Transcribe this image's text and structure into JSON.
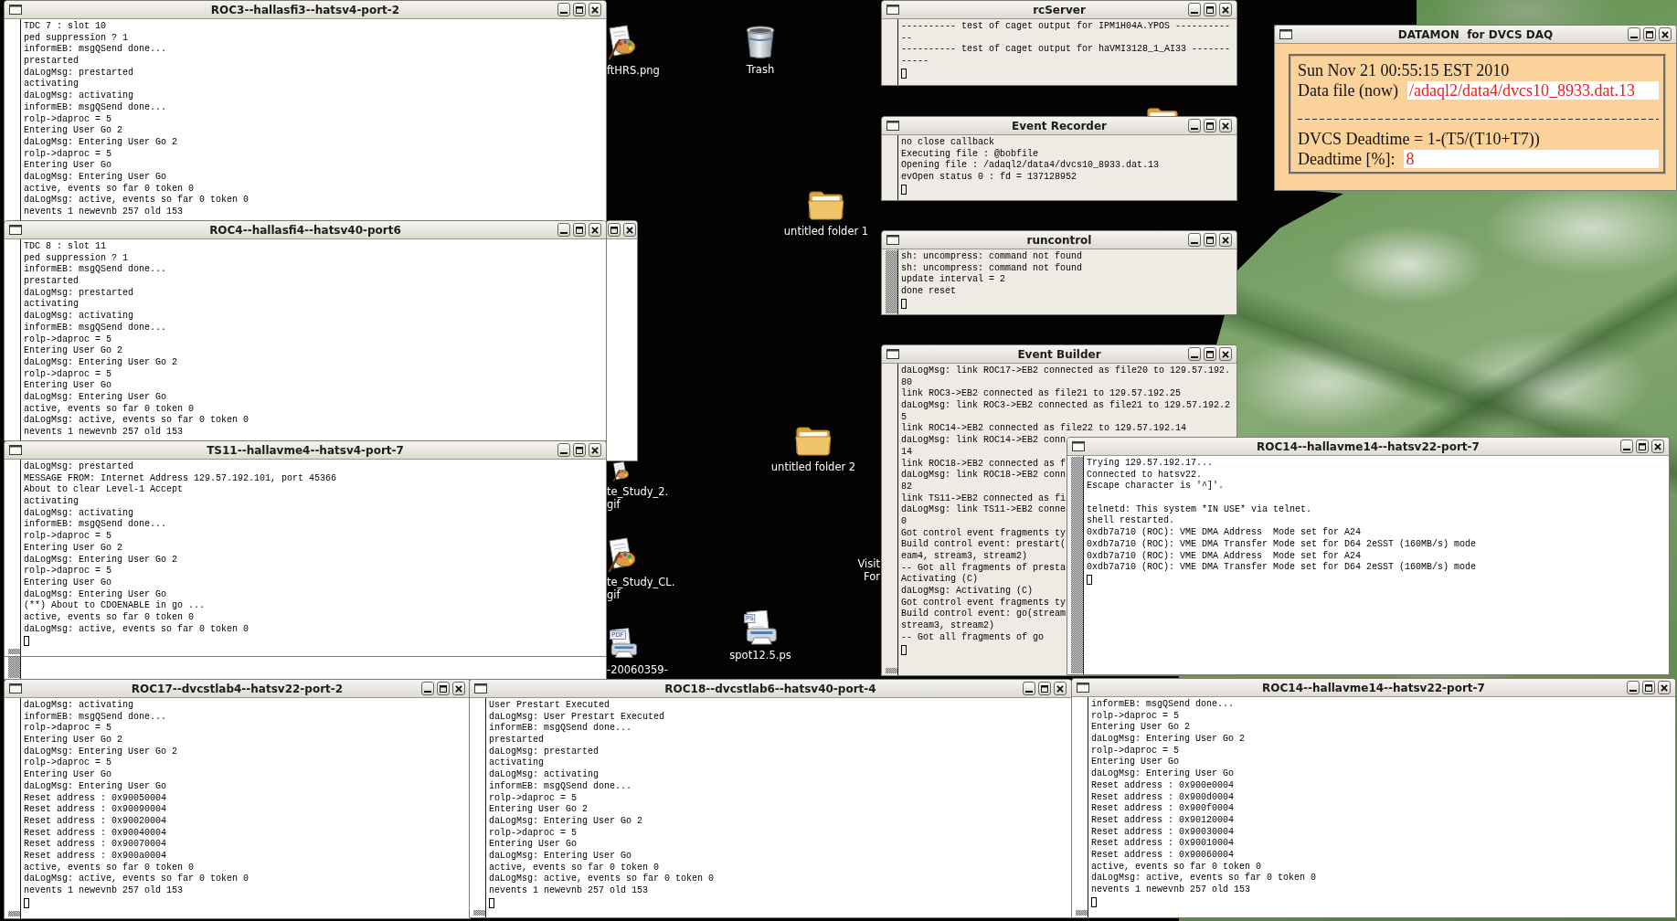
{
  "desktop": {
    "icons": [
      {
        "kind": "image",
        "label": [
          "ftHRS.png"
        ]
      },
      {
        "kind": "trash",
        "label": [
          "Trash"
        ]
      },
      {
        "kind": "folder"
      },
      {
        "kind": "folder",
        "label": [
          "untitled folder 1"
        ]
      },
      {
        "kind": "folder",
        "label": [
          "untitled folder 2"
        ]
      },
      {
        "kind": "image",
        "label": [
          "te_Study_2.",
          "gif"
        ]
      },
      {
        "kind": "link",
        "label": [
          "Visit",
          "For"
        ]
      },
      {
        "kind": "image",
        "label": [
          "te_Study_CL.",
          "gif"
        ]
      },
      {
        "kind": "ps",
        "badge": "PS",
        "label": [
          "spot12.5.ps"
        ]
      },
      {
        "kind": "pdf",
        "badge": "PDF",
        "label": [
          "-20060359-"
        ]
      }
    ]
  },
  "windows": [
    {
      "kind": "fragment",
      "title_bar": true
    },
    {
      "kind": "fragment",
      "scroll_thumb": {
        "kind": "full"
      }
    },
    {
      "kind": "terminal",
      "title": "ROC3--hallasfi3--hatsv4-port-2",
      "cursor": false,
      "output": [
        [
          "TDC 7 : slot 10",
          "ped suppression ? 1",
          "informEB: msgQSend done...",
          "prestarted",
          "daLogMsg: prestarted",
          "activating",
          "daLogMsg: activating",
          "informEB: msgQSend done...",
          "rolp->daproc = 5",
          "Entering User Go 2",
          "daLogMsg: Entering User Go 2",
          "rolp->daproc = 5",
          "Entering User Go",
          "daLogMsg: Entering User Go",
          "active, events so far 0 token 0",
          "daLogMsg: active, events so far 0 token 0",
          "nevents 1 newevnb 257 old 153"
        ]
      ]
    },
    {
      "kind": "terminal",
      "title": "ROC4--hallasfi4--hatsv40-port6",
      "cursor": false,
      "output": [
        [
          "TDC 8 : slot 11",
          "ped suppression ? 1",
          "informEB: msgQSend done...",
          "prestarted",
          "daLogMsg: prestarted",
          "activating",
          "daLogMsg: activating",
          "informEB: msgQSend done...",
          "rolp->daproc = 5",
          "Entering User Go 2",
          "daLogMsg: Entering User Go 2",
          "rolp->daproc = 5",
          "Entering User Go",
          "daLogMsg: Entering User Go",
          "active, events so far 0 token 0",
          "daLogMsg: active, events so far 0 token 0",
          "nevents 1 newevnb 257 old 153"
        ]
      ]
    },
    {
      "kind": "terminal",
      "title": "TS11--hallavme4--hatsv4-port-7",
      "cursor": true,
      "scroll_thumb": {
        "kind": "bottom"
      },
      "output": [
        [
          "daLogMsg: prestarted",
          "MESSAGE FROM: Internet Address 129.57.192.101, port 45366",
          "About to clear Level-1 Accept",
          "activating",
          "daLogMsg: activating",
          "informEB: msgQSend done...",
          "rolp->daproc = 5",
          "Entering User Go 2",
          "daLogMsg: Entering User Go 2",
          "rolp->daproc = 5",
          "Entering User Go",
          "daLogMsg: Entering User Go",
          "(**) About to CDOENABLE in go ...",
          "active, events so far 0 token 0",
          "daLogMsg: active, events so far 0 token 0"
        ]
      ]
    },
    {
      "kind": "terminal",
      "title": "ROC17--dvcstlab4--hatsv22-port-2",
      "cursor": true,
      "scroll_thumb": {
        "kind": "bottom"
      },
      "output": [
        [
          "daLogMsg: activating",
          "informEB: msgQSend done...",
          "rolp->daproc = 5",
          "Entering User Go 2",
          "daLogMsg: Entering User Go 2",
          "rolp->daproc = 5",
          "Entering User Go",
          "daLogMsg: Entering User Go",
          "Reset address : 0x90050004",
          "Reset address : 0x90090004",
          "Reset address : 0x90020004",
          "Reset address : 0x90040004",
          "Reset address : 0x90070004",
          "Reset address : 0x900a0004",
          "active, events so far 0 token 0",
          "daLogMsg: active, events so far 0 token 0",
          "nevents 1 newevnb 257 old 153"
        ]
      ]
    },
    {
      "kind": "terminal",
      "title": "ROC18--dvcstlab6--hatsv40-port-4",
      "cursor": true,
      "scroll_thumb": {
        "kind": "bottom"
      },
      "output": [
        [
          "User Prestart Executed",
          "daLogMsg: User Prestart Executed",
          "informEB: msgQSend done...",
          "prestarted",
          "daLogMsg: prestarted",
          "activating",
          "daLogMsg: activating",
          "informEB: msgQSend done...",
          "rolp->daproc = 5",
          "Entering User Go 2",
          "daLogMsg: Entering User Go 2",
          "rolp->daproc = 5",
          "Entering User Go",
          "daLogMsg: Entering User Go",
          "active, events so far 0 token 0",
          "daLogMsg: active, events so far 0 token 0",
          "nevents 1 newevnb 257 old 153"
        ]
      ]
    },
    {
      "kind": "terminal",
      "title": "ROC14--hallavme14--hatsv22-port-7",
      "cursor": true,
      "scroll_thumb": {
        "kind": "bottom"
      },
      "output": [
        [
          "informEB: msgQSend done...",
          "rolp->daproc = 5",
          "Entering User Go 2",
          "daLogMsg: Entering User Go 2",
          "rolp->daproc = 5",
          "Entering User Go",
          "daLogMsg: Entering User Go",
          "Reset address : 0x900e0004",
          "Reset address : 0x900d0004",
          "Reset address : 0x900f0004",
          "Reset address : 0x90120004",
          "Reset address : 0x90030004",
          "Reset address : 0x90010004",
          "Reset address : 0x90060004",
          "active, events so far 0 token 0",
          "daLogMsg: active, events so far 0 token 0",
          "nevents 1 newevnb 257 old 153"
        ]
      ]
    },
    {
      "kind": "console",
      "title": "rcServer",
      "cursor": true,
      "output": [
        [
          "---------- test of caget output for IPM1H04A.YPOS ----------",
          "--",
          "---------- test of caget output for haVMI3128_1_AI33 -------",
          "-----"
        ]
      ]
    },
    {
      "kind": "console",
      "title": "Event Recorder",
      "cursor": true,
      "output": [
        [
          "no close callback",
          "Executing file : @bobfile",
          "Opening file : /adaql2/data4/dvcs10_8933.dat.13",
          "evOpen status 0 : fd = 137128952"
        ]
      ]
    },
    {
      "kind": "console",
      "title": "runcontrol",
      "cursor": true,
      "scroll_thumb": {
        "kind": "full"
      },
      "output": [
        [
          "sh: uncompress: command not found",
          "sh: uncompress: command not found",
          "update interval = 2",
          "done reset"
        ]
      ]
    },
    {
      "kind": "console",
      "title": "Event Builder",
      "cursor": true,
      "scroll_thumb": {
        "kind": "bottom"
      },
      "output": [
        [
          "daLogMsg: link ROC17->EB2 connected as file20 to 129.57.192.",
          "80",
          "link ROC3->EB2 connected as file21 to 129.57.192.25",
          "daLogMsg: link ROC3->EB2 connected as file21 to 129.57.192.2",
          "5",
          "link ROC14->EB2 connected as file22 to 129.57.192.14",
          "daLogMsg: link ROC14->EB2 conn",
          "14",
          "link ROC18->EB2 connected as f",
          "daLogMsg: link ROC18->EB2 conn",
          "82",
          "link TS11->EB2 connected as fi",
          "daLogMsg: link TS11->EB2 conne",
          "0",
          "Got control event fragments ty",
          "Build control event: prestart(",
          "eam4, stream3, stream2)",
          "-- Got all fragments of presta",
          "Activating (C)",
          "daLogMsg: Activating (C)",
          "Got control event fragments ty",
          "Build control event: go(stream",
          "stream3, stream2)",
          "-- Got all fragments of go"
        ]
      ]
    },
    {
      "kind": "terminal",
      "title": "ROC14--hallavme14--hatsv22-port-7",
      "cursor": true,
      "scroll_thumb": {
        "kind": "full"
      },
      "output": [
        [
          "Trying 129.57.192.17...",
          "Connected to hatsv22.",
          "Escape character is '^]'."
        ],
        [
          "telnetd: This system *IN USE* via telnet.",
          "shell restarted.",
          "0xdb7a710 (ROC): VME DMA Address  Mode set for A24",
          "0xdb7a710 (ROC): VME DMA Transfer Mode set for D64 2eSST (160MB/s) mode",
          "0xdb7a710 (ROC): VME DMA Address  Mode set for A24",
          "0xdb7a710 (ROC): VME DMA Transfer Mode set for D64 2eSST (160MB/s) mode"
        ]
      ]
    },
    {
      "kind": "monitor",
      "title": "DATAMON  for DVCS DAQ",
      "rows": [
        {
          "kind": "text",
          "text": "Sun Nov 21 00:55:15 EST 2010"
        },
        {
          "kind": "field",
          "label": "Data file (now)",
          "value": "/adaql2/data4/dvcs10_8933.dat.13"
        },
        {
          "kind": "divider"
        },
        {
          "kind": "text",
          "text": "DVCS Deadtime = 1-(T5/(T10+T7))"
        },
        {
          "kind": "field",
          "label": "Deadtime [%]:",
          "value": "8"
        }
      ]
    }
  ]
}
